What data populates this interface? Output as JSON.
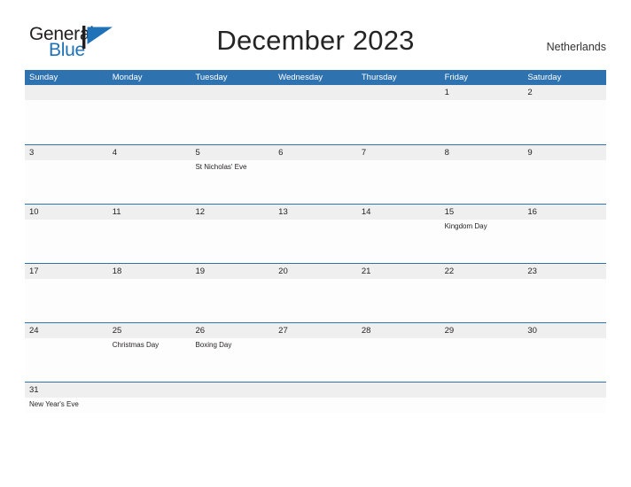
{
  "brand": {
    "name_top": "General",
    "name_bottom": "Blue",
    "flag_color": "#2072b8",
    "text_color": "#231f20"
  },
  "header": {
    "title": "December 2023",
    "country": "Netherlands"
  },
  "theme": {
    "header_blue": "#2e72af",
    "band_gray": "#efefef",
    "cell_white": "#fdfdfd",
    "text_dark": "#231f20"
  },
  "calendar": {
    "weekdays": [
      "Sunday",
      "Monday",
      "Tuesday",
      "Wednesday",
      "Thursday",
      "Friday",
      "Saturday"
    ],
    "weeks": [
      {
        "days": [
          {
            "date": "",
            "event": ""
          },
          {
            "date": "",
            "event": ""
          },
          {
            "date": "",
            "event": ""
          },
          {
            "date": "",
            "event": ""
          },
          {
            "date": "",
            "event": ""
          },
          {
            "date": "1",
            "event": ""
          },
          {
            "date": "2",
            "event": ""
          }
        ]
      },
      {
        "days": [
          {
            "date": "3",
            "event": ""
          },
          {
            "date": "4",
            "event": ""
          },
          {
            "date": "5",
            "event": "St Nicholas' Eve"
          },
          {
            "date": "6",
            "event": ""
          },
          {
            "date": "7",
            "event": ""
          },
          {
            "date": "8",
            "event": ""
          },
          {
            "date": "9",
            "event": ""
          }
        ]
      },
      {
        "days": [
          {
            "date": "10",
            "event": ""
          },
          {
            "date": "11",
            "event": ""
          },
          {
            "date": "12",
            "event": ""
          },
          {
            "date": "13",
            "event": ""
          },
          {
            "date": "14",
            "event": ""
          },
          {
            "date": "15",
            "event": "Kingdom Day"
          },
          {
            "date": "16",
            "event": ""
          }
        ]
      },
      {
        "days": [
          {
            "date": "17",
            "event": ""
          },
          {
            "date": "18",
            "event": ""
          },
          {
            "date": "19",
            "event": ""
          },
          {
            "date": "20",
            "event": ""
          },
          {
            "date": "21",
            "event": ""
          },
          {
            "date": "22",
            "event": ""
          },
          {
            "date": "23",
            "event": ""
          }
        ]
      },
      {
        "days": [
          {
            "date": "24",
            "event": ""
          },
          {
            "date": "25",
            "event": "Christmas Day"
          },
          {
            "date": "26",
            "event": "Boxing Day"
          },
          {
            "date": "27",
            "event": ""
          },
          {
            "date": "28",
            "event": ""
          },
          {
            "date": "29",
            "event": ""
          },
          {
            "date": "30",
            "event": ""
          }
        ]
      },
      {
        "days": [
          {
            "date": "31",
            "event": "New Year's Eve"
          },
          {
            "date": "",
            "event": ""
          },
          {
            "date": "",
            "event": ""
          },
          {
            "date": "",
            "event": ""
          },
          {
            "date": "",
            "event": ""
          },
          {
            "date": "",
            "event": ""
          },
          {
            "date": "",
            "event": ""
          }
        ]
      }
    ]
  }
}
